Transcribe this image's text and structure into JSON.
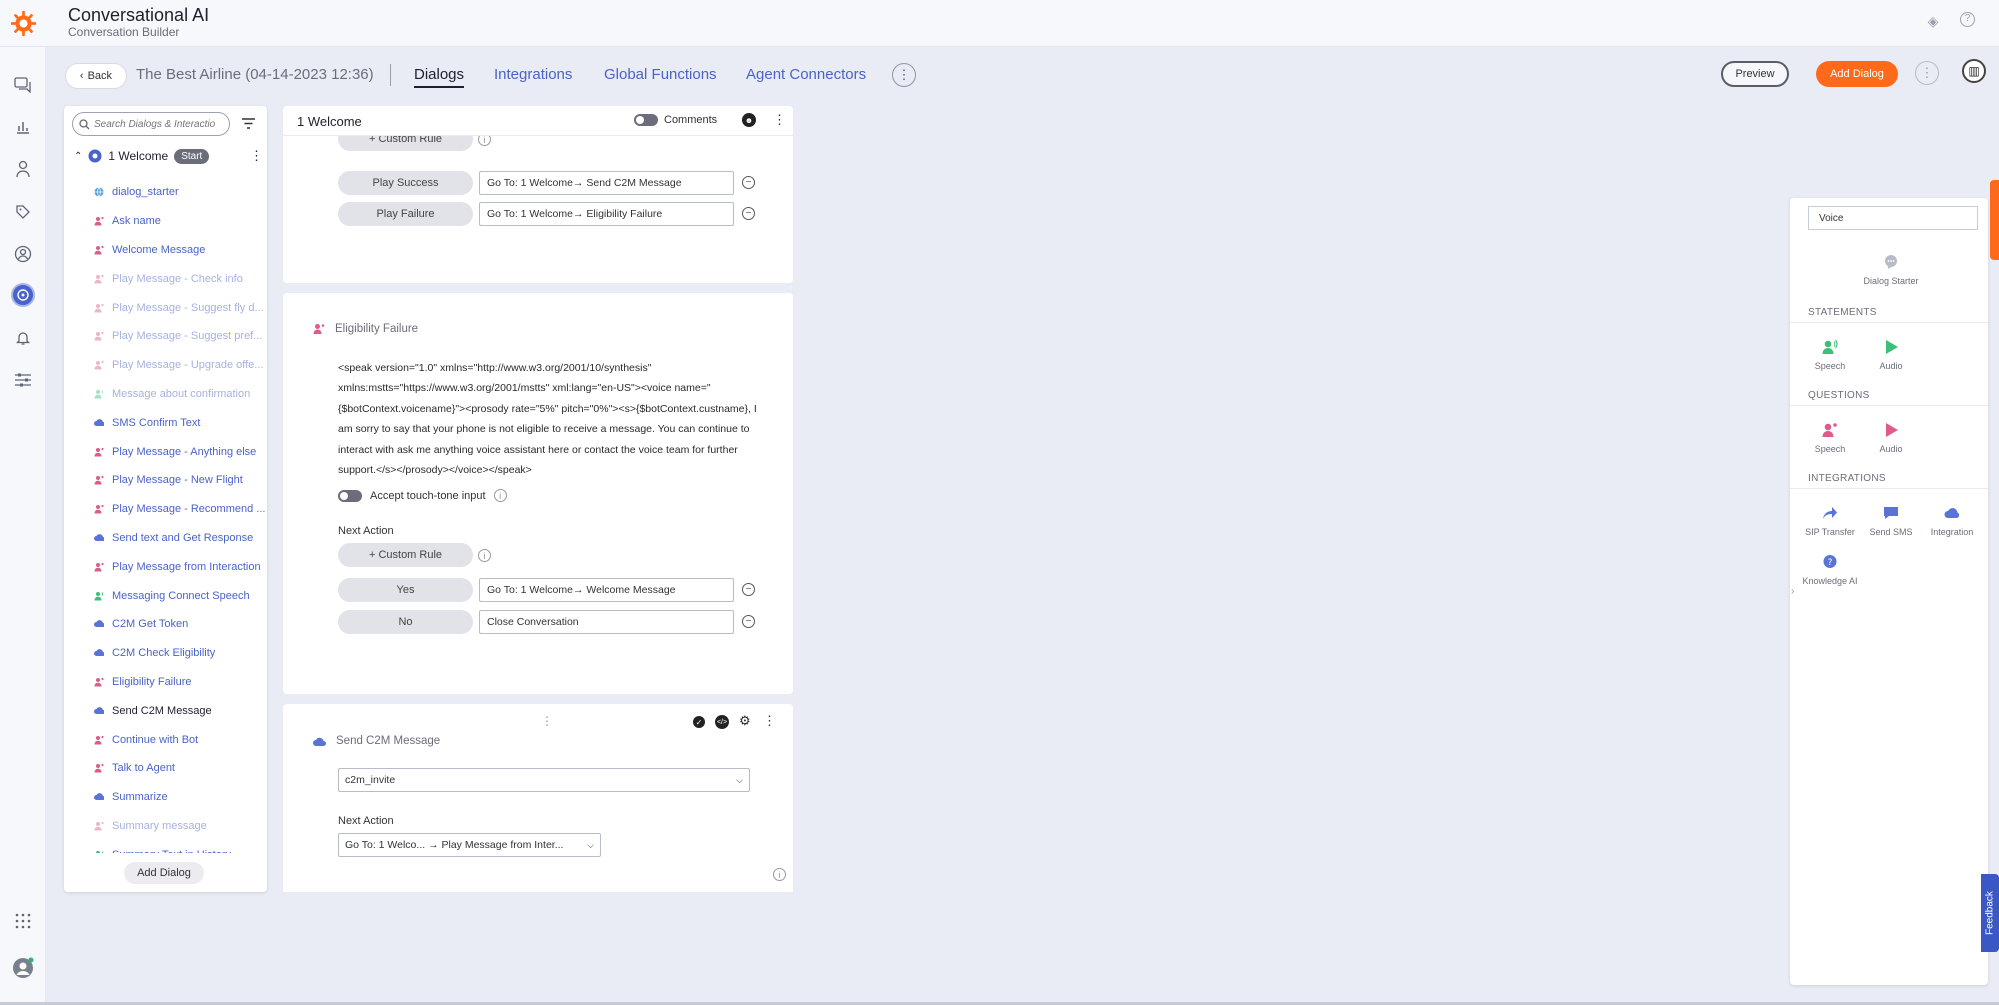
{
  "header": {
    "title": "Conversational AI",
    "subtitle": "Conversation Builder"
  },
  "toolbar": {
    "back_label": "Back",
    "project_name": "The Best Airline (04-14-2023 12:36)",
    "tabs": [
      "Dialogs",
      "Integrations",
      "Global Functions",
      "Agent Connectors"
    ],
    "active_tab": "Dialogs",
    "preview_label": "Preview",
    "add_dialog_label": "Add Dialog"
  },
  "dialogs_panel": {
    "search_placeholder": "Search Dialogs & Interactio",
    "group_name": "1 Welcome",
    "group_badge": "Start",
    "items": [
      {
        "label": "dialog_starter",
        "icon": "globe-icon",
        "color": "#4a9be0",
        "state": "normal"
      },
      {
        "label": "Ask name",
        "icon": "speech-question-icon",
        "color": "#e05a8a",
        "state": "normal"
      },
      {
        "label": "Welcome Message",
        "icon": "speech-question-icon",
        "color": "#e05a8a",
        "state": "normal"
      },
      {
        "label": "Play Message - Check info",
        "icon": "speech-question-icon",
        "color": "#e05a8a",
        "state": "faded"
      },
      {
        "label": "Play Message - Suggest fly d...",
        "icon": "speech-question-icon",
        "color": "#e05a8a",
        "state": "faded"
      },
      {
        "label": "Play Message - Suggest pref...",
        "icon": "speech-question-icon",
        "color": "#e05a8a",
        "state": "faded"
      },
      {
        "label": "Play Message - Upgrade offe...",
        "icon": "speech-question-icon",
        "color": "#e05a8a",
        "state": "faded"
      },
      {
        "label": "Message about confirmation",
        "icon": "speech-statement-icon",
        "color": "#3cbf7a",
        "state": "faded"
      },
      {
        "label": "SMS Confirm Text",
        "icon": "cloud-icon",
        "color": "#5a74d6",
        "state": "normal"
      },
      {
        "label": "Play Message - Anything else",
        "icon": "speech-question-icon",
        "color": "#e05a8a",
        "state": "normal"
      },
      {
        "label": "Play Message - New Flight",
        "icon": "speech-question-icon",
        "color": "#e05a8a",
        "state": "normal"
      },
      {
        "label": "Play Message - Recommend ...",
        "icon": "speech-question-icon",
        "color": "#e05a8a",
        "state": "normal"
      },
      {
        "label": "Send text and Get Response",
        "icon": "cloud-icon",
        "color": "#5a74d6",
        "state": "normal"
      },
      {
        "label": "Play Message from Interaction",
        "icon": "speech-question-icon",
        "color": "#e05a8a",
        "state": "normal"
      },
      {
        "label": "Messaging Connect Speech",
        "icon": "speech-statement-icon",
        "color": "#3cbf7a",
        "state": "normal"
      },
      {
        "label": "C2M Get Token",
        "icon": "cloud-icon",
        "color": "#5a74d6",
        "state": "normal"
      },
      {
        "label": "C2M Check Eligibility",
        "icon": "cloud-icon",
        "color": "#5a74d6",
        "state": "normal"
      },
      {
        "label": "Eligibility Failure",
        "icon": "speech-question-icon",
        "color": "#e05a8a",
        "state": "normal"
      },
      {
        "label": "Send C2M Message",
        "icon": "cloud-icon",
        "color": "#5a74d6",
        "state": "current"
      },
      {
        "label": "Continue with Bot",
        "icon": "speech-question-icon",
        "color": "#e05a8a",
        "state": "normal"
      },
      {
        "label": "Talk to Agent",
        "icon": "speech-question-icon",
        "color": "#e05a8a",
        "state": "normal"
      },
      {
        "label": "Summarize",
        "icon": "cloud-icon",
        "color": "#5a74d6",
        "state": "normal"
      },
      {
        "label": "Summary message",
        "icon": "speech-question-icon",
        "color": "#e05a8a",
        "state": "faded"
      },
      {
        "label": "Summary Text in History",
        "icon": "speech-statement-icon",
        "color": "#3cbf7a",
        "state": "normal"
      }
    ],
    "add_dialog_label": "Add Dialog"
  },
  "canvas": {
    "title": "1 Welcome",
    "comments_label": "Comments",
    "card1": {
      "custom_rule_label": "+ Custom Rule",
      "rows": [
        {
          "rule": "Play Success",
          "action": "Go To: 1 Welcome→  Send C2M Message"
        },
        {
          "rule": "Play Failure",
          "action": "Go To: 1 Welcome→  Eligibility Failure"
        }
      ]
    },
    "card2": {
      "name": "Eligibility Failure",
      "ssml": "<speak version=\"1.0\" xmlns=\"http://www.w3.org/2001/10/synthesis\" xmlns:mstts=\"https://www.w3.org/2001/mstts\" xml:lang=\"en-US\"><voice name=\"{$botContext.voicename}\"><prosody rate=\"5%\" pitch=\"0%\"><s>{$botContext.custname}, I am sorry to say that your phone is not eligible to receive a message. You can continue to interact with ask me anything voice assistant here or contact the voice team for further support.</s></prosody></voice></speak>",
      "touch_tone_label": "Accept touch-tone input",
      "next_action_label": "Next Action",
      "custom_rule_label": "+ Custom Rule",
      "rows": [
        {
          "rule": "Yes",
          "action": "Go To: 1 Welcome→  Welcome Message"
        },
        {
          "rule": "No",
          "action": "Close Conversation"
        }
      ]
    },
    "card3": {
      "name": "Send C2M Message",
      "select_value": "c2m_invite",
      "next_action_label": "Next Action",
      "next_action_value": "Go To: 1 Welco... →  Play Message from Inter..."
    }
  },
  "palette": {
    "channel": "Voice",
    "dialog_starter_label": "Dialog Starter",
    "sections": {
      "statements": "STATEMENTS",
      "questions": "QUESTIONS",
      "integrations": "INTEGRATIONS"
    },
    "statements": [
      {
        "label": "Speech",
        "icon": "speech-statement-icon",
        "color": "#3cbf7a"
      },
      {
        "label": "Audio",
        "icon": "play-icon",
        "color": "#3cbf7a"
      }
    ],
    "questions": [
      {
        "label": "Speech",
        "icon": "speech-question-icon",
        "color": "#e05a8a"
      },
      {
        "label": "Audio",
        "icon": "play-icon",
        "color": "#e05a8a"
      }
    ],
    "integrations": [
      {
        "label": "SIP Transfer",
        "icon": "share-arrow-icon",
        "color": "#5a74d6"
      },
      {
        "label": "Send SMS",
        "icon": "chat-bubble-icon",
        "color": "#5a74d6"
      },
      {
        "label": "Integration",
        "icon": "cloud-icon",
        "color": "#5a74d6"
      },
      {
        "label": "Knowledge AI",
        "icon": "question-bubble-icon",
        "color": "#5a74d6"
      }
    ]
  },
  "feedback_label": "Feedback",
  "colors": {
    "accent": "#4a63c9",
    "brand_orange": "#ff6a1a"
  }
}
